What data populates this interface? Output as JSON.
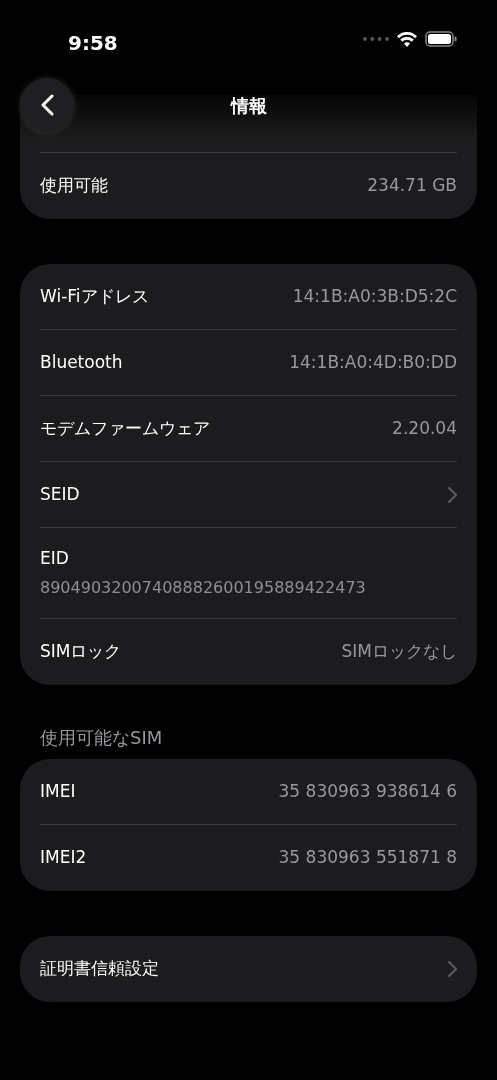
{
  "status_bar": {
    "time": "9:58"
  },
  "header": {
    "title": "情報"
  },
  "sections": [
    {
      "rows": [
        {
          "kind": "value",
          "label": "使用可能",
          "value": "234.71 GB"
        }
      ]
    },
    {
      "rows": [
        {
          "kind": "value",
          "label": "Wi-Fiアドレス",
          "value": "14:1B:A0:3B:D5:2C"
        },
        {
          "kind": "value",
          "label": "Bluetooth",
          "value": "14:1B:A0:4D:B0:DD"
        },
        {
          "kind": "value",
          "label": "モデムファームウェア",
          "value": "2.20.04"
        },
        {
          "kind": "chevron",
          "label": "SEID"
        },
        {
          "kind": "stacked",
          "label": "EID",
          "value": "89049032007408882600195889422473"
        },
        {
          "kind": "value",
          "label": "SIMロック",
          "value": "SIMロックなし"
        }
      ]
    },
    {
      "header": "使用可能なSIM",
      "rows": [
        {
          "kind": "value",
          "label": "IMEI",
          "value": "35 830963 938614 6"
        },
        {
          "kind": "value",
          "label": "IMEI2",
          "value": "35 830963 551871 8"
        }
      ]
    },
    {
      "rows": [
        {
          "kind": "chevron",
          "label": "証明書信頼設定"
        }
      ]
    }
  ]
}
